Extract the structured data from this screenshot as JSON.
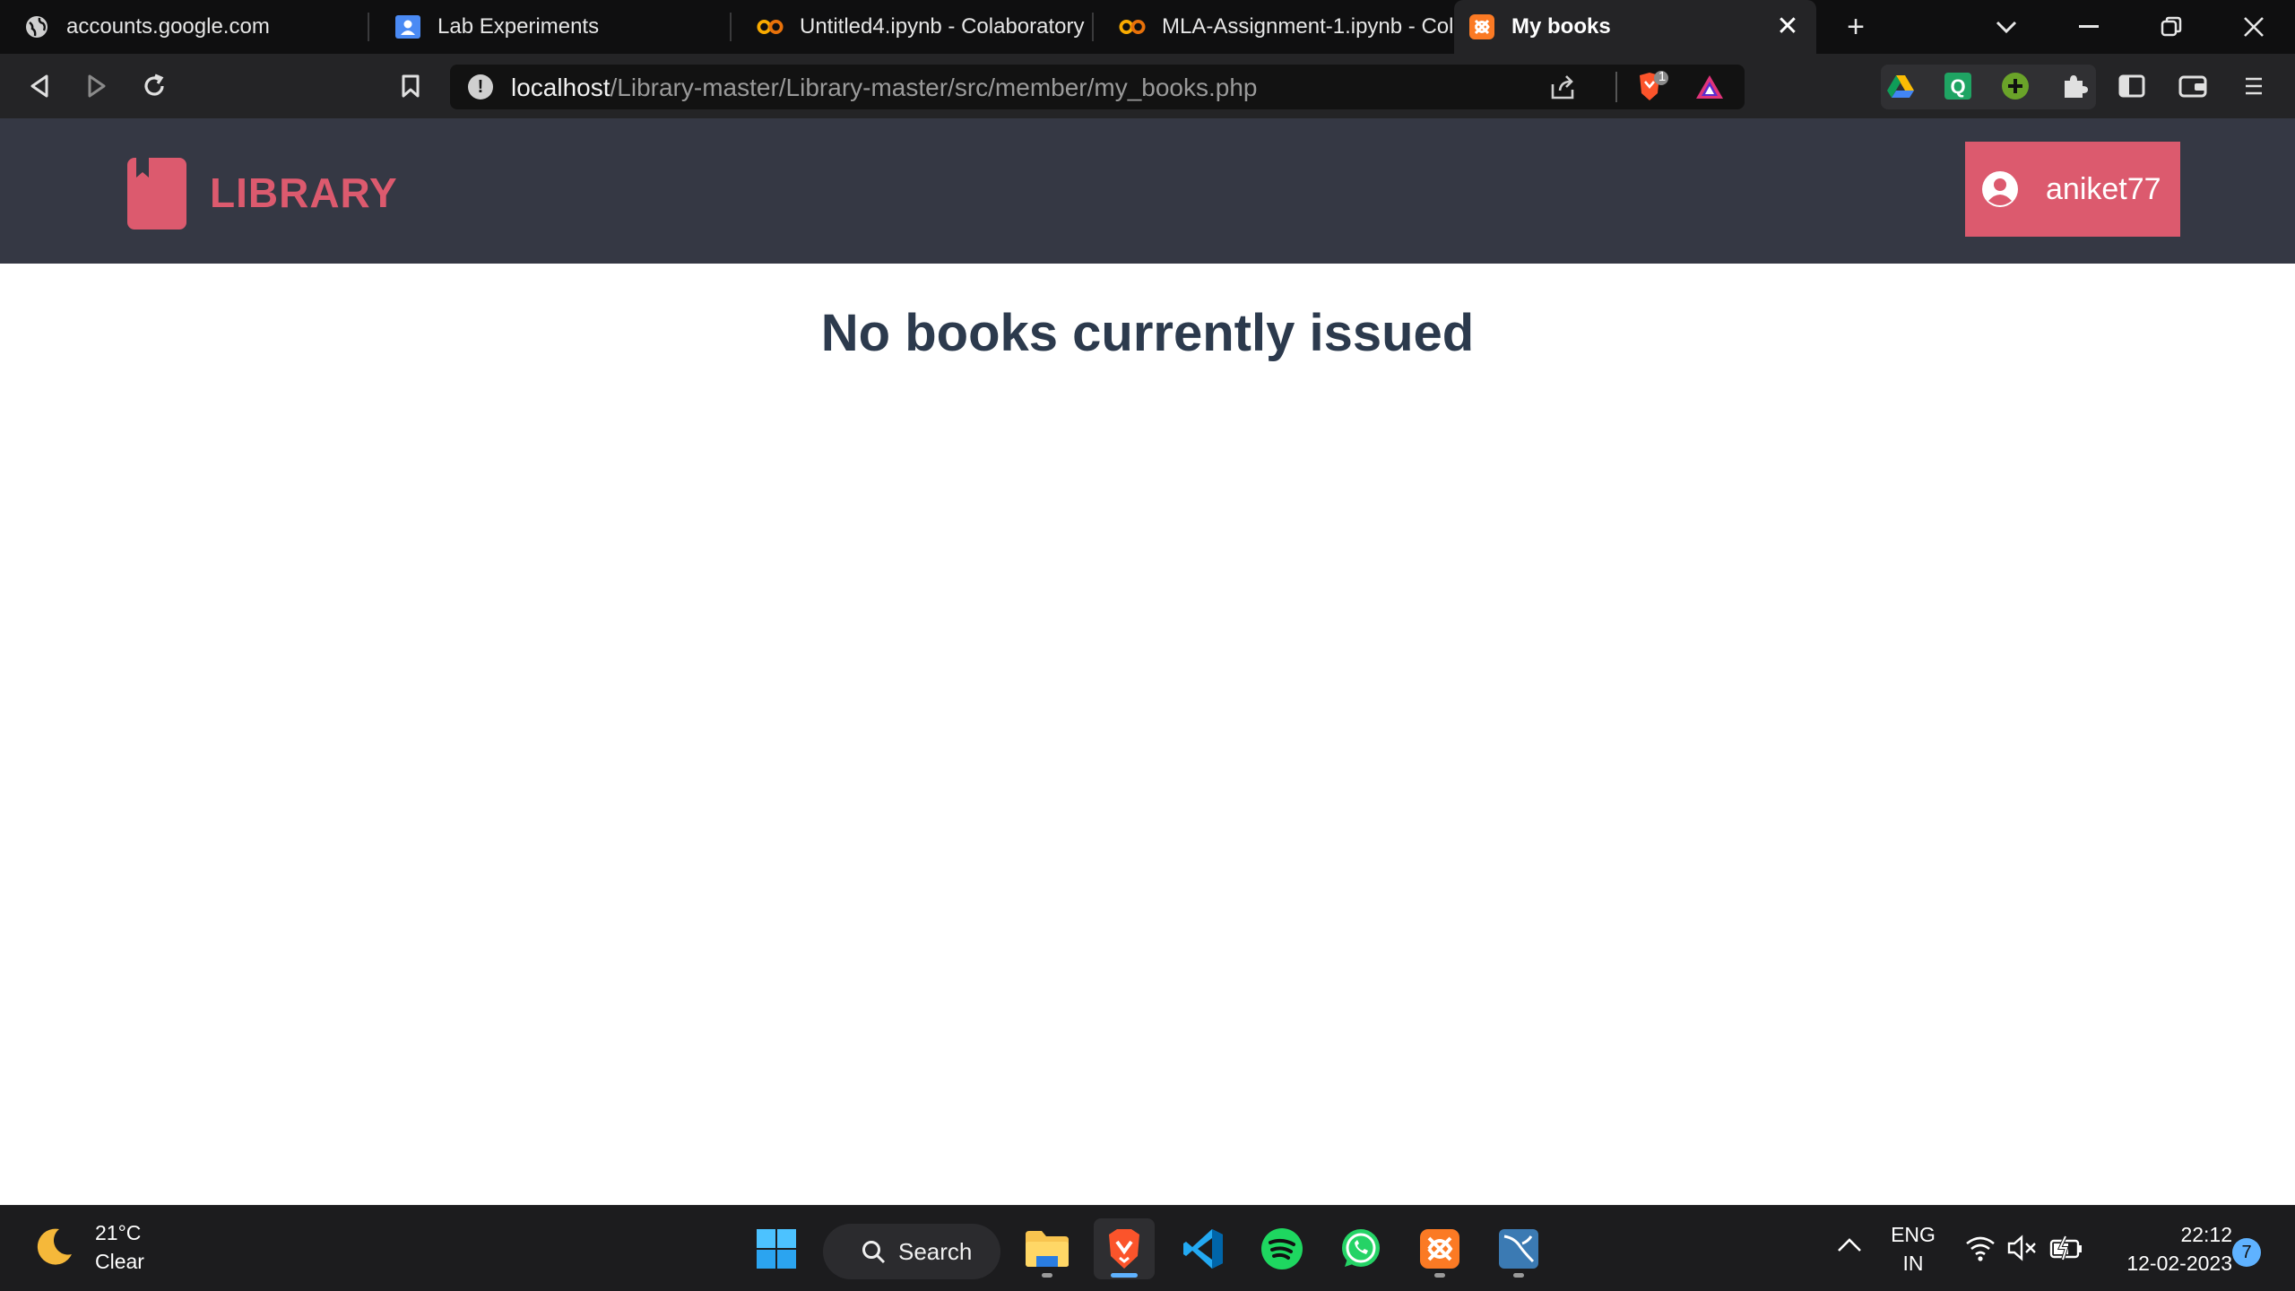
{
  "browser": {
    "tabs": [
      {
        "title": "accounts.google.com",
        "icon": "globe-icon",
        "active": false
      },
      {
        "title": "Lab Experiments",
        "icon": "contacts-icon",
        "active": false
      },
      {
        "title": "Untitled4.ipynb - Colaboratory",
        "icon": "colab-icon",
        "active": false
      },
      {
        "title": "MLA-Assignment-1.ipynb - Col",
        "icon": "colab-icon",
        "active": false
      },
      {
        "title": "My books",
        "icon": "xampp-icon",
        "active": true
      }
    ],
    "tab_close_glyph": "✕",
    "new_tab_glyph": "+",
    "url_host": "localhost",
    "url_path": "/Library-master/Library-master/src/member/my_books.php",
    "brave_shield_count": "1"
  },
  "site": {
    "logo_text": "LIBRARY",
    "username": "aniket77",
    "empty_message": "No books currently issued",
    "accent_color": "#dc5a6e",
    "header_color": "#353844"
  },
  "taskbar": {
    "weather_temp": "21°C",
    "weather_desc": "Clear",
    "search_label": "Search",
    "lang_top": "ENG",
    "lang_bottom": "IN",
    "time": "22:12",
    "date": "12-02-2023",
    "notification_count": "7"
  }
}
